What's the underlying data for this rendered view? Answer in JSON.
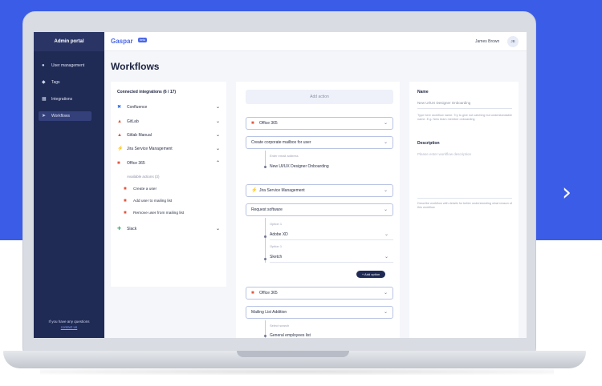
{
  "colors": {
    "background_blue": "#3b5ce6",
    "sidebar": "#1f2a55",
    "brand": "#4a67e8",
    "accent_orange": "#e2573f"
  },
  "sidebar": {
    "title": "Admin portal",
    "items": [
      {
        "label": "User management",
        "icon": "user-icon"
      },
      {
        "label": "Tags",
        "icon": "tag-icon"
      },
      {
        "label": "Integrations",
        "icon": "grid-icon"
      },
      {
        "label": "Workflows",
        "icon": "workflow-icon",
        "active": true
      }
    ],
    "footer_text": "If you have any questions",
    "footer_link": "contact us"
  },
  "header": {
    "logo": "Gaspar",
    "badge": "beta",
    "user_name": "James Brown",
    "avatar_initials": "JB"
  },
  "page_title": "Workflows",
  "integrations": {
    "heading": "Connected integrations (6 / 17)",
    "items": [
      {
        "label": "Confluence",
        "icon": "confluence-icon"
      },
      {
        "label": "GitLab",
        "icon": "gitlab-icon"
      },
      {
        "label": "Gitlab Manual",
        "icon": "gitlab-icon"
      },
      {
        "label": "Jira Service Management",
        "icon": "jira-icon"
      },
      {
        "label": "Office 365",
        "icon": "office-icon",
        "expanded": true
      },
      {
        "label": "Slack",
        "icon": "slack-icon"
      }
    ],
    "available_label": "Available actions (3)",
    "actions": [
      "Create a user",
      "Add user to mailing list",
      "Remove user from mailing list"
    ]
  },
  "builder": {
    "add_action": "Add action",
    "steps": {
      "office1": "Office 365",
      "create_mailbox": "Create corporate mailbox for user",
      "mailbox_label": "Enter email address",
      "mailbox_value": "New UI/UX Designer Onboarding",
      "jira": "Jira Service Management",
      "request_software": "Request software",
      "option1_label": "Option 1",
      "option1_value": "Adobe XD",
      "option2_label": "Option 1",
      "option2_value": "Sketch",
      "add_option": "+ Add option",
      "office2": "Office 365",
      "mailing_list": "Mailing List Addition",
      "mailing_label": "Select search",
      "mailing_value": "General employees list"
    }
  },
  "details": {
    "name_label": "Name",
    "name_value": "New UI/UX Designer Onboarding",
    "name_help": "Type here workflow name. Try to give not catching but understandable name. E.g. New team member onboarding",
    "description_label": "Description",
    "description_placeholder": "Please enter workflow description",
    "description_help": "Describe workflow with details for better understanding what reason of this workflow"
  }
}
